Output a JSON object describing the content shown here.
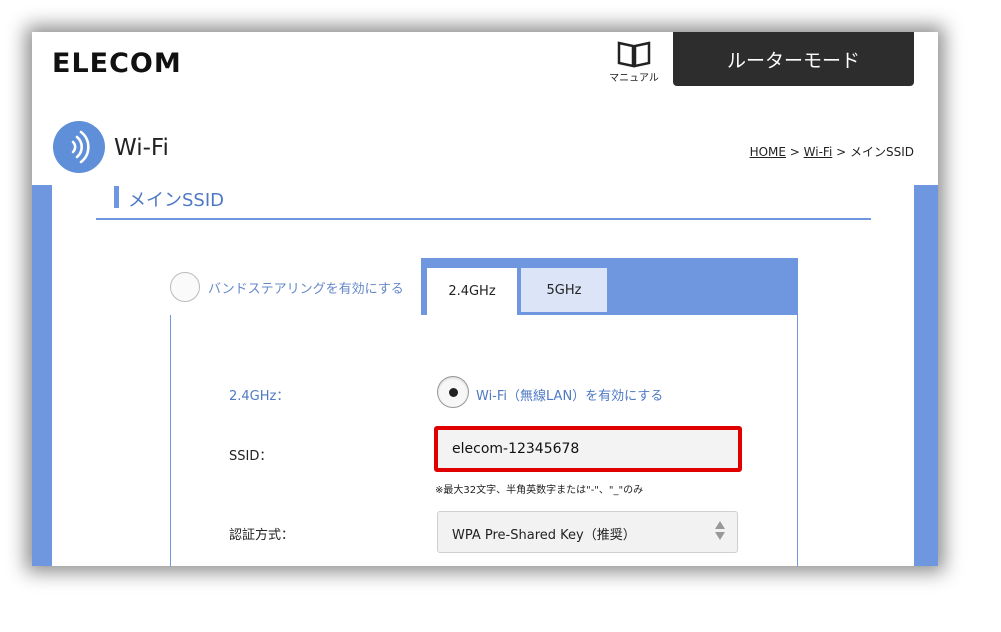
{
  "header": {
    "logo": "ELECOM",
    "manual_label": "マニュアル",
    "mode_button": "ルーターモード"
  },
  "page": {
    "title": "Wi-Fi",
    "breadcrumb": {
      "home": "HOME",
      "sep1": " > ",
      "wifi": "Wi-Fi",
      "sep2": " > ",
      "current": "メインSSID"
    }
  },
  "section": {
    "title": "メインSSID"
  },
  "band_steering": {
    "label": "バンドステアリングを有効にする",
    "checked": false
  },
  "tabs": [
    {
      "label": "2.4GHz",
      "active": true
    },
    {
      "label": "5GHz",
      "active": false
    }
  ],
  "form": {
    "band_label": "2.4GHz：",
    "enable_label": "Wi-Fi（無線LAN）を有効にする",
    "enable_checked": true,
    "ssid_label": "SSID：",
    "ssid_value": "elecom-12345678",
    "ssid_hint": "※最大32文字、半角英数字または\"-\"、\"_\"のみ",
    "auth_label": "認証方式：",
    "auth_value": "WPA Pre-Shared Key（推奨）"
  },
  "colors": {
    "accent": "#6f97e0",
    "highlight": "#e00000",
    "mode_button_bg": "#2d2d2d"
  },
  "icons": [
    "book-icon",
    "wifi-icon",
    "select-arrows-icon"
  ]
}
